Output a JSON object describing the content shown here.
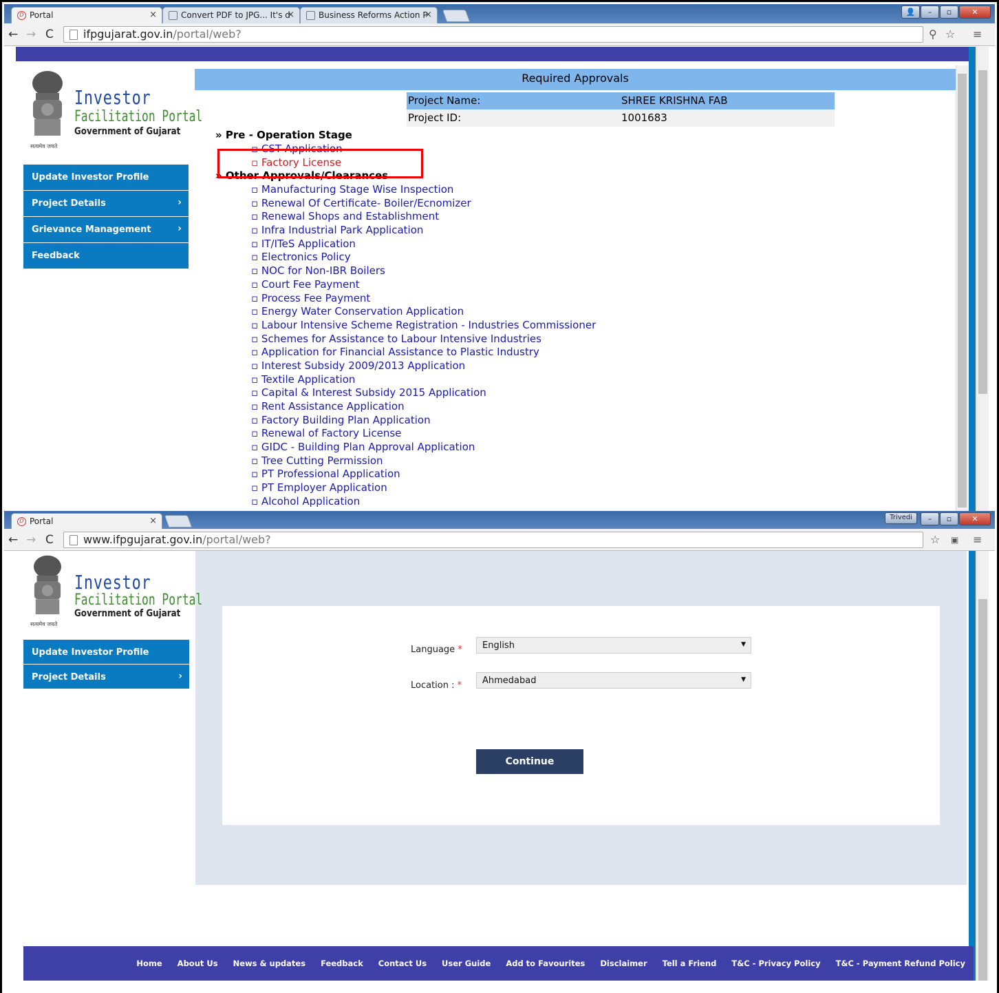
{
  "top_window": {
    "tabs": [
      {
        "label": "Portal"
      },
      {
        "label": "Convert PDF to JPG... It's d"
      },
      {
        "label": "Business Reforms Action P"
      }
    ],
    "url_host": "ifpgujarat.gov.in",
    "url_path": "/portal/web?",
    "page": {
      "section_title": "Required Approvals",
      "project_name_label": "Project Name:",
      "project_name_value": "SHREE KRISHNA FAB",
      "project_id_label": "Project ID:",
      "project_id_value": "1001683",
      "pre_operation_heading": "» Pre - Operation Stage",
      "pre_operation_items": [
        "▫ CST Application",
        "▫ Factory License"
      ],
      "other_heading": "» Other Approvals/Clearances",
      "other_items": [
        "▫ Manufacturing Stage Wise Inspection",
        "▫ Renewal Of Certificate- Boiler/Ecnomizer",
        "▫ Renewal Shops and Establishment",
        "▫ Infra Industrial Park Application",
        "▫ IT/ITeS Application",
        "▫ Electronics Policy",
        "▫ NOC for Non-IBR Boilers",
        "▫ Court Fee Payment",
        "▫ Process Fee Payment",
        "▫ Energy Water Conservation Application",
        "▫ Labour Intensive Scheme Registration - Industries Commissioner",
        "▫ Schemes for Assistance to Labour Intensive Industries",
        "▫ Application for Financial Assistance to Plastic Industry",
        "▫ Interest Subsidy 2009/2013 Application",
        "▫ Textile Application",
        "▫ Capital & Interest Subsidy 2015 Application",
        "▫ Rent Assistance Application",
        "▫ Factory Building Plan Application",
        "▫ Renewal of Factory License",
        "▫ GIDC - Building Plan Approval Application",
        "▫ Tree Cutting Permission",
        "▫ PT Professional Application",
        "▫ PT Employer Application",
        "▫ Alcohol Application"
      ],
      "menu": [
        {
          "label": "Update Investor Profile",
          "arrow": ""
        },
        {
          "label": "Project Details",
          "arrow": "›"
        },
        {
          "label": "Grievance Management",
          "arrow": "›"
        },
        {
          "label": "Feedback",
          "arrow": ""
        }
      ]
    }
  },
  "bottom_window": {
    "tabs": [
      {
        "label": "Portal"
      }
    ],
    "user_badge": "Trivedi",
    "url_host": "www.ifpgujarat.gov.in",
    "url_path": "/portal/web?",
    "menu": [
      {
        "label": "Update Investor Profile",
        "arrow": ""
      },
      {
        "label": "Project Details",
        "arrow": "›"
      }
    ],
    "form": {
      "language_label": "Language",
      "language_value": "English",
      "location_label": "Location :",
      "location_value": "Ahmedabad",
      "required_mark": "*",
      "continue_label": "Continue"
    },
    "footer_links": [
      "Home",
      "About Us",
      "News & updates",
      "Feedback",
      "Contact Us",
      "User Guide",
      "Add to Favourites",
      "Disclaimer",
      "Tell a Friend",
      "T&C - Privacy Policy",
      "T&C - Payment Refund Policy"
    ]
  },
  "logo": {
    "line1": "Investor",
    "line2": "Facilitation Portal",
    "line3": "Government of Gujarat",
    "motto": "सत्यमेव जयते"
  },
  "colors": {
    "menu_blue": "#0a7bc1",
    "header_band": "#7fb6ec",
    "link_blue": "#1a1ab0",
    "highlight_red": "#d02020",
    "footer_navy": "#3f3fa8",
    "button_navy": "#2a3f63"
  }
}
